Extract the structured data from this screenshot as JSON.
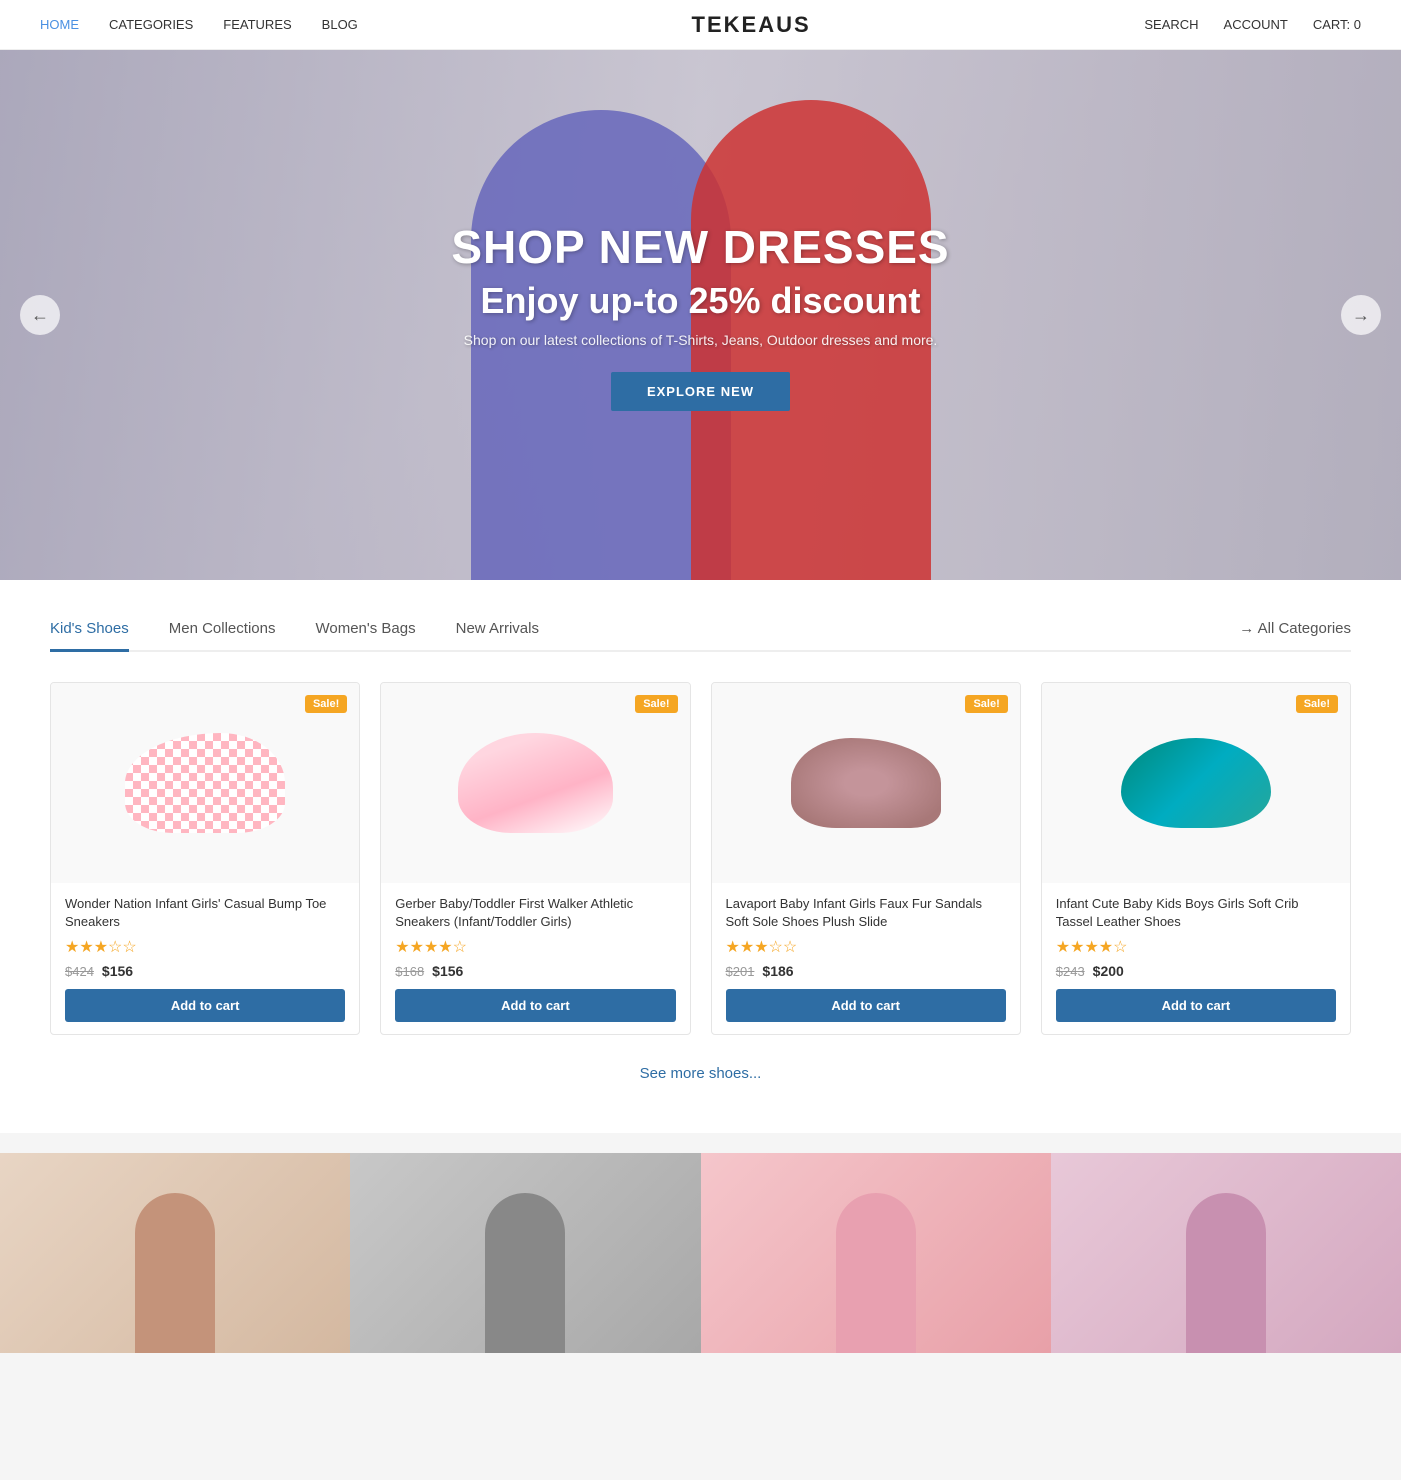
{
  "nav": {
    "brand": "TEKEAUS",
    "links": [
      {
        "label": "HOME",
        "active": true
      },
      {
        "label": "CATEGORIES",
        "active": false
      },
      {
        "label": "FEATURES",
        "active": false
      },
      {
        "label": "BLOG",
        "active": false
      }
    ],
    "right_links": [
      {
        "label": "SEARCH"
      },
      {
        "label": "ACCOUNT"
      },
      {
        "label": "CART: 0"
      }
    ]
  },
  "hero": {
    "heading1": "SHOP NEW DRESSES",
    "heading2": "Enjoy up-to 25% discount",
    "subtext": "Shop on our latest collections of T-Shirts, Jeans, Outdoor dresses and more.",
    "button_label": "EXPLORE NEW",
    "arrow_left": "←",
    "arrow_right": "→"
  },
  "tabs": [
    {
      "label": "Kid's Shoes",
      "active": true
    },
    {
      "label": "Men Collections",
      "active": false
    },
    {
      "label": "Women's Bags",
      "active": false
    },
    {
      "label": "New Arrivals",
      "active": false
    },
    {
      "label": "→ All Categories",
      "active": false
    }
  ],
  "products": [
    {
      "name": "Wonder Nation Infant Girls' Casual Bump Toe Sneakers",
      "sale": "Sale!",
      "rating": 3,
      "max_rating": 5,
      "price_old": "$424",
      "price_new": "$156",
      "button_label": "Add to cart",
      "shoe_class": "shoe-img-1"
    },
    {
      "name": "Gerber Baby/Toddler First Walker Athletic Sneakers (Infant/Toddler Girls)",
      "sale": "Sale!",
      "rating": 4,
      "max_rating": 5,
      "price_old": "$168",
      "price_new": "$156",
      "button_label": "Add to cart",
      "shoe_class": "shoe-img-2"
    },
    {
      "name": "Lavaport Baby Infant Girls Faux Fur Sandals Soft Sole Shoes Plush Slide",
      "sale": "Sale!",
      "rating": 3,
      "max_rating": 5,
      "price_old": "$201",
      "price_new": "$186",
      "button_label": "Add to cart",
      "shoe_class": "shoe-img-3"
    },
    {
      "name": "Infant Cute Baby Kids Boys Girls Soft Crib Tassel Leather Shoes",
      "sale": "Sale!",
      "rating": 4,
      "max_rating": 5,
      "price_old": "$243",
      "price_new": "$200",
      "button_label": "Add to cart",
      "shoe_class": "shoe-img-4"
    }
  ],
  "see_more": "See more shoes...",
  "colors": {
    "primary": "#2e6da4",
    "sale_badge": "#f5a623",
    "star_active": "#f5a623",
    "star_empty": "#ddd"
  }
}
